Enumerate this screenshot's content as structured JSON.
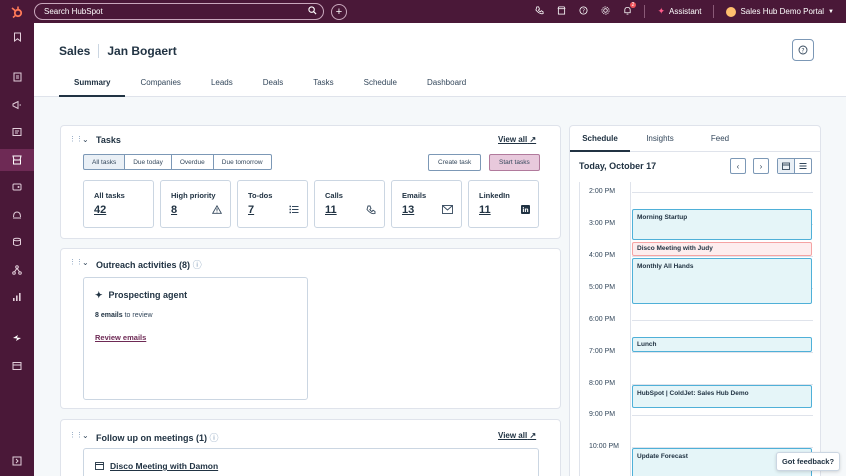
{
  "topbar": {
    "logo": "⚙",
    "search_placeholder": "Search HubSpot",
    "notification_count": "2",
    "assistant": "Assistant",
    "portal": "Sales Hub Demo Portal"
  },
  "header": {
    "title": "Sales",
    "name": "Jan Bogaert",
    "tabs": [
      "Summary",
      "Companies",
      "Leads",
      "Deals",
      "Tasks",
      "Schedule",
      "Dashboard"
    ]
  },
  "tasks": {
    "title": "Tasks",
    "view_all": "View all",
    "filters": [
      "All tasks",
      "Due today",
      "Overdue",
      "Due tomorrow"
    ],
    "create_task": "Create task",
    "start_tasks": "Start tasks",
    "stats": [
      {
        "label": "All tasks",
        "value": "42"
      },
      {
        "label": "High priority",
        "value": "8"
      },
      {
        "label": "To-dos",
        "value": "7"
      },
      {
        "label": "Calls",
        "value": "11"
      },
      {
        "label": "Emails",
        "value": "13"
      },
      {
        "label": "LinkedIn",
        "value": "11"
      }
    ]
  },
  "outreach": {
    "title": "Outreach activities (8)",
    "agent_title": "Prospecting agent",
    "emails_count": "8 emails",
    "emails_suffix": "to review",
    "review_link": "Review emails"
  },
  "meetings": {
    "title": "Follow up on meetings (1)",
    "view_all": "View all",
    "meeting": "Disco Meeting with Damon"
  },
  "schedule": {
    "tabs": [
      "Schedule",
      "Insights",
      "Feed"
    ],
    "date": "Today, October 17",
    "hours": [
      "2:00 PM",
      "3:00 PM",
      "4:00 PM",
      "5:00 PM",
      "6:00 PM",
      "7:00 PM",
      "8:00 PM",
      "9:00 PM",
      "10:00 PM"
    ],
    "events": [
      {
        "title": "Morning Startup"
      },
      {
        "title": "Disco Meeting with Judy"
      },
      {
        "title": "Monthly All Hands"
      },
      {
        "title": "Lunch"
      },
      {
        "title": "HubSpot | ColdJet: Sales Hub Demo"
      },
      {
        "title": "Update Forecast"
      }
    ]
  },
  "feedback": "Got feedback?"
}
